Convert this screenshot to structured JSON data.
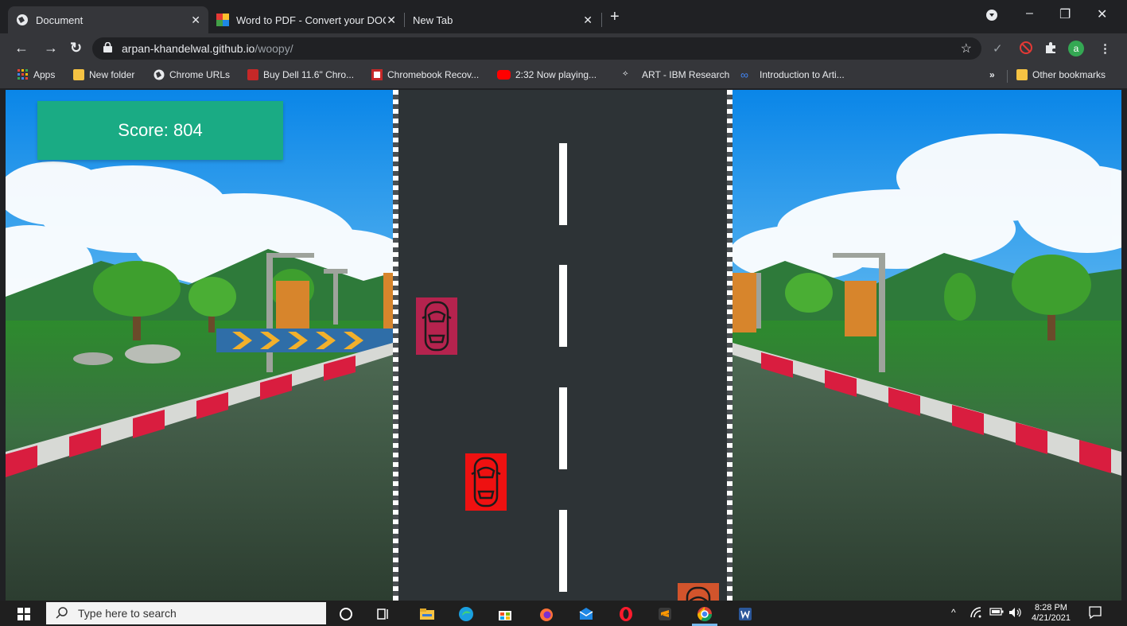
{
  "browser": {
    "tabs": [
      {
        "title": "Document",
        "active": true
      },
      {
        "title": "Word to PDF - Convert your DOC",
        "active": false
      },
      {
        "title": "New Tab",
        "active": false
      }
    ],
    "url_host": "arpan-khandelwal.github.io",
    "url_path": "/woopy/",
    "profile_initial": "a",
    "bookmarks": [
      "Apps",
      "New folder",
      "Chrome URLs",
      "Buy Dell 11.6\" Chro...",
      "Chromebook Recov...",
      "2:32 Now playing...",
      "ART - IBM Research",
      "Introduction to Arti..."
    ],
    "bookmarks_overflow": "»",
    "other_bookmarks": "Other bookmarks"
  },
  "game": {
    "score_label": "Score: 804",
    "cars": [
      {
        "name": "enemy-car-crimson",
        "color": "#b5234e"
      },
      {
        "name": "player-car",
        "color": "#ee1111"
      },
      {
        "name": "enemy-car-orange",
        "color": "#d2542c"
      }
    ],
    "colors": {
      "road": "#2d3336",
      "score_bg": "#1aab84"
    }
  },
  "taskbar": {
    "search_placeholder": "Type here to search",
    "time": "8:28 PM",
    "date": "4/21/2021"
  }
}
